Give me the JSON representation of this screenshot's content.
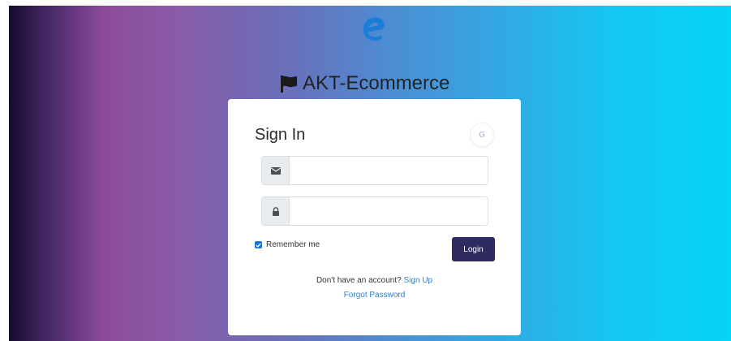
{
  "brand": {
    "name": "AKT-Ecommerce"
  },
  "signin": {
    "title": "Sign In",
    "google_label": "G",
    "email_value": "",
    "password_value": "",
    "remember_label": "Remember me",
    "remember_checked": true,
    "login_label": "Login",
    "no_account_text": "Don't have an account?",
    "signup_label": "Sign Up",
    "forgot_label": "Forgot Password"
  },
  "colors": {
    "login_button": "#2d2b5f",
    "link": "#2f7ed8",
    "logo": "#1a7ed6",
    "checkbox": "#1e73d8"
  },
  "icons": {
    "logo": "e-logo-icon",
    "brand": "flag-icon",
    "email": "envelope-icon",
    "password": "lock-icon",
    "google": "google-icon"
  }
}
